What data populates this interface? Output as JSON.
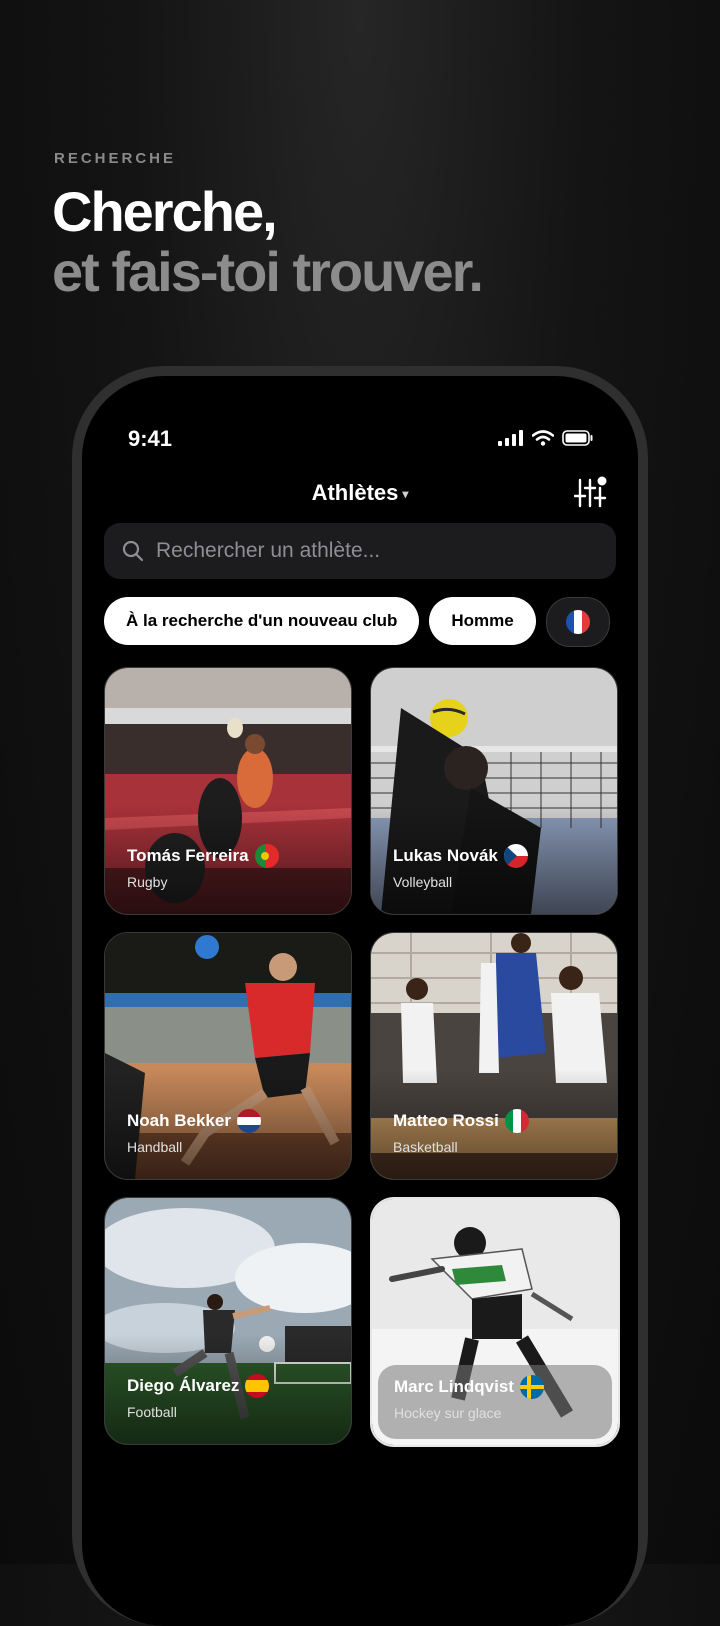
{
  "hero": {
    "eyebrow": "RECHERCHE",
    "headline_1": "Cherche,",
    "headline_2": "et fais-toi trouver."
  },
  "status": {
    "time": "9:41"
  },
  "nav": {
    "title": "Athlètes",
    "caret": "▾",
    "filter_icon": "sliders-icon"
  },
  "search": {
    "placeholder": "Rechercher un athlète...",
    "icon": "search-icon"
  },
  "chips": [
    {
      "label": "À la recherche d'un nouveau club"
    },
    {
      "label": "Homme"
    },
    {
      "label": "",
      "flag": "france"
    }
  ],
  "athletes": [
    {
      "name": "Tomás Ferreira",
      "sport": "Rugby",
      "flag": "portugal"
    },
    {
      "name": "Lukas Novák",
      "sport": "Volleyball",
      "flag": "czechia"
    },
    {
      "name": "Noah Bekker",
      "sport": "Handball",
      "flag": "netherlands"
    },
    {
      "name": "Matteo Rossi",
      "sport": "Basketball",
      "flag": "italy"
    },
    {
      "name": "Diego Álvarez",
      "sport": "Football",
      "flag": "spain"
    },
    {
      "name": "Marc Lindqvist",
      "sport": "Hockey sur glace",
      "flag": "sweden"
    }
  ],
  "colors": {
    "background": "#0b0b0b",
    "chip": "#ffffff",
    "search": "#1c1c1e"
  }
}
